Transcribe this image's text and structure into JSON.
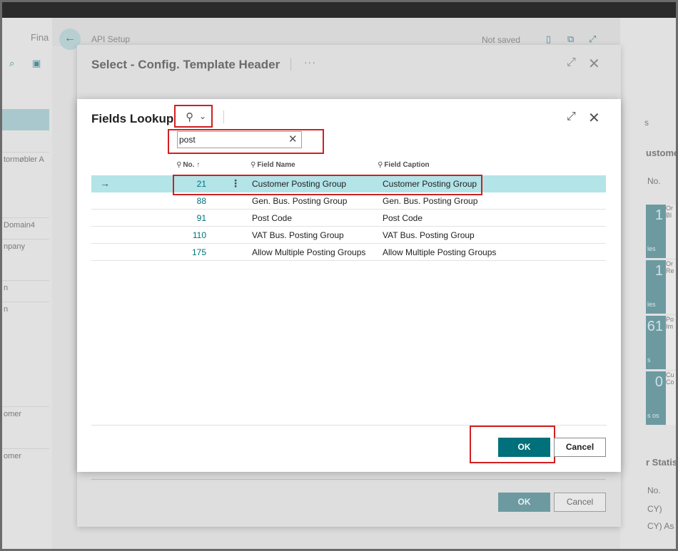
{
  "background": {
    "app_title": "Fina",
    "page_title": "API Setup",
    "status": "Not saved",
    "left_items": [
      "tormøbler A",
      "Domain4",
      "npany",
      "n",
      "n",
      "omer",
      "omer"
    ],
    "right_texts": [
      "s",
      "ustome",
      "No.",
      "r Statis",
      "No.",
      "CY)",
      "CY) As V"
    ],
    "tiles": [
      {
        "number": "1",
        "label": "les",
        "side": "Or Bl"
      },
      {
        "number": "1",
        "label": "les",
        "side": "Or Re"
      },
      {
        "number": "61",
        "label": "s",
        "side": "Po Im"
      },
      {
        "number": "0",
        "label": "s os",
        "side": "Cu Co"
      }
    ]
  },
  "outer_dialog": {
    "title": "Select - Config. Template Header",
    "more": "···",
    "ok_label": "OK",
    "cancel_label": "Cancel"
  },
  "lookup": {
    "title": "Fields Lookup",
    "search_value": "post",
    "columns": {
      "no": "No.",
      "sort": "↑",
      "field_name": "Field Name",
      "field_caption": "Field Caption"
    },
    "rows": [
      {
        "no": "21",
        "field_name": "Customer Posting Group",
        "field_caption": "Customer Posting Group",
        "selected": true
      },
      {
        "no": "88",
        "field_name": "Gen. Bus. Posting Group",
        "field_caption": "Gen. Bus. Posting Group",
        "selected": false
      },
      {
        "no": "91",
        "field_name": "Post Code",
        "field_caption": "Post Code",
        "selected": false
      },
      {
        "no": "110",
        "field_name": "VAT Bus. Posting Group",
        "field_caption": "VAT Bus. Posting Group",
        "selected": false
      },
      {
        "no": "175",
        "field_name": "Allow Multiple Posting Groups",
        "field_caption": "Allow Multiple Posting Groups",
        "selected": false
      }
    ],
    "ok_label": "OK",
    "cancel_label": "Cancel"
  },
  "icons": {
    "back": "back-arrow-icon",
    "search": "search-icon",
    "chevron": "chevron-down-icon",
    "expand": "expand-icon",
    "close": "close-icon",
    "clear": "clear-icon",
    "row_pointer": "row-arrow-icon",
    "row_menu": "row-actions-icon"
  },
  "colors": {
    "accent": "#00707b",
    "selected_row": "#b2e4e8",
    "highlight": "#d0201f"
  }
}
